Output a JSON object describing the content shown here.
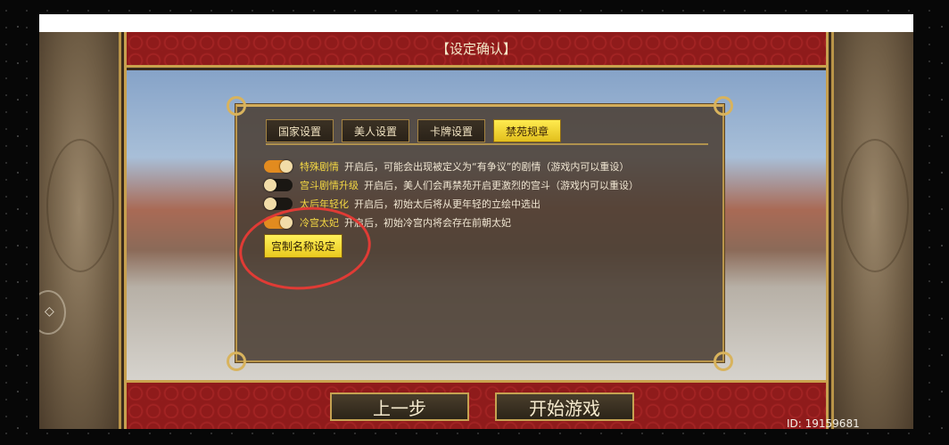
{
  "window": {
    "title": "【设定确认】"
  },
  "tabs": [
    {
      "label": "国家设置",
      "active": false
    },
    {
      "label": "美人设置",
      "active": false
    },
    {
      "label": "卡牌设置",
      "active": false
    },
    {
      "label": "禁苑规章",
      "active": true
    }
  ],
  "settings": [
    {
      "label": "特殊剧情",
      "description": "开启后，可能会出现被定义为“有争议”的剧情（游戏内可以重设）",
      "enabled": true
    },
    {
      "label": "宫斗剧情升级",
      "description": "开启后，美人们会再禁苑开启更激烈的宫斗（游戏内可以重设）",
      "enabled": false
    },
    {
      "label": "太后年轻化",
      "description": "开启后，初始太后将从更年轻的立绘中选出",
      "enabled": false
    },
    {
      "label": "冷宫太妃",
      "description": "开启后，初始冷宫内将会存在前朝太妃",
      "enabled": true
    }
  ],
  "palace_name_button": "宫制名称设定",
  "footer": {
    "prev_label": "上一步",
    "start_label": "开始游戏",
    "id_text": "ID: 19159681"
  },
  "side_control_glyph": "◇",
  "colors": {
    "accent_red": "#8f1b1b",
    "gold_border": "#c9a24d",
    "active_tab": "#f2d83a",
    "label_yellow": "#f4d843",
    "toggle_on": "#e28b1f",
    "highlight_circle": "#e03b35"
  }
}
